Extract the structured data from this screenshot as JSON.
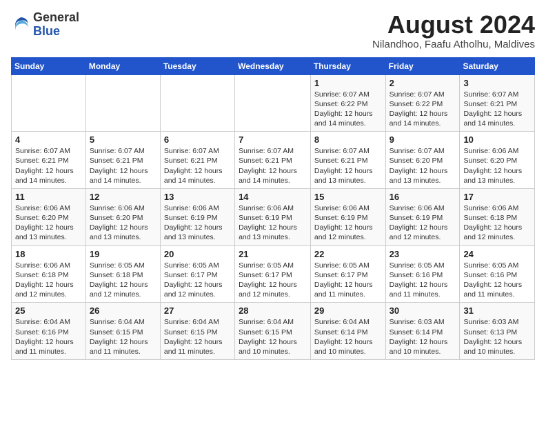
{
  "header": {
    "logo_general": "General",
    "logo_blue": "Blue",
    "title": "August 2024",
    "subtitle": "Nilandhoo, Faafu Atholhu, Maldives"
  },
  "calendar": {
    "days_of_week": [
      "Sunday",
      "Monday",
      "Tuesday",
      "Wednesday",
      "Thursday",
      "Friday",
      "Saturday"
    ],
    "weeks": [
      [
        {
          "day": "",
          "detail": ""
        },
        {
          "day": "",
          "detail": ""
        },
        {
          "day": "",
          "detail": ""
        },
        {
          "day": "",
          "detail": ""
        },
        {
          "day": "1",
          "detail": "Sunrise: 6:07 AM\nSunset: 6:22 PM\nDaylight: 12 hours\nand 14 minutes."
        },
        {
          "day": "2",
          "detail": "Sunrise: 6:07 AM\nSunset: 6:22 PM\nDaylight: 12 hours\nand 14 minutes."
        },
        {
          "day": "3",
          "detail": "Sunrise: 6:07 AM\nSunset: 6:21 PM\nDaylight: 12 hours\nand 14 minutes."
        }
      ],
      [
        {
          "day": "4",
          "detail": "Sunrise: 6:07 AM\nSunset: 6:21 PM\nDaylight: 12 hours\nand 14 minutes."
        },
        {
          "day": "5",
          "detail": "Sunrise: 6:07 AM\nSunset: 6:21 PM\nDaylight: 12 hours\nand 14 minutes."
        },
        {
          "day": "6",
          "detail": "Sunrise: 6:07 AM\nSunset: 6:21 PM\nDaylight: 12 hours\nand 14 minutes."
        },
        {
          "day": "7",
          "detail": "Sunrise: 6:07 AM\nSunset: 6:21 PM\nDaylight: 12 hours\nand 14 minutes."
        },
        {
          "day": "8",
          "detail": "Sunrise: 6:07 AM\nSunset: 6:21 PM\nDaylight: 12 hours\nand 13 minutes."
        },
        {
          "day": "9",
          "detail": "Sunrise: 6:07 AM\nSunset: 6:20 PM\nDaylight: 12 hours\nand 13 minutes."
        },
        {
          "day": "10",
          "detail": "Sunrise: 6:06 AM\nSunset: 6:20 PM\nDaylight: 12 hours\nand 13 minutes."
        }
      ],
      [
        {
          "day": "11",
          "detail": "Sunrise: 6:06 AM\nSunset: 6:20 PM\nDaylight: 12 hours\nand 13 minutes."
        },
        {
          "day": "12",
          "detail": "Sunrise: 6:06 AM\nSunset: 6:20 PM\nDaylight: 12 hours\nand 13 minutes."
        },
        {
          "day": "13",
          "detail": "Sunrise: 6:06 AM\nSunset: 6:19 PM\nDaylight: 12 hours\nand 13 minutes."
        },
        {
          "day": "14",
          "detail": "Sunrise: 6:06 AM\nSunset: 6:19 PM\nDaylight: 12 hours\nand 13 minutes."
        },
        {
          "day": "15",
          "detail": "Sunrise: 6:06 AM\nSunset: 6:19 PM\nDaylight: 12 hours\nand 12 minutes."
        },
        {
          "day": "16",
          "detail": "Sunrise: 6:06 AM\nSunset: 6:19 PM\nDaylight: 12 hours\nand 12 minutes."
        },
        {
          "day": "17",
          "detail": "Sunrise: 6:06 AM\nSunset: 6:18 PM\nDaylight: 12 hours\nand 12 minutes."
        }
      ],
      [
        {
          "day": "18",
          "detail": "Sunrise: 6:06 AM\nSunset: 6:18 PM\nDaylight: 12 hours\nand 12 minutes."
        },
        {
          "day": "19",
          "detail": "Sunrise: 6:05 AM\nSunset: 6:18 PM\nDaylight: 12 hours\nand 12 minutes."
        },
        {
          "day": "20",
          "detail": "Sunrise: 6:05 AM\nSunset: 6:17 PM\nDaylight: 12 hours\nand 12 minutes."
        },
        {
          "day": "21",
          "detail": "Sunrise: 6:05 AM\nSunset: 6:17 PM\nDaylight: 12 hours\nand 12 minutes."
        },
        {
          "day": "22",
          "detail": "Sunrise: 6:05 AM\nSunset: 6:17 PM\nDaylight: 12 hours\nand 11 minutes."
        },
        {
          "day": "23",
          "detail": "Sunrise: 6:05 AM\nSunset: 6:16 PM\nDaylight: 12 hours\nand 11 minutes."
        },
        {
          "day": "24",
          "detail": "Sunrise: 6:05 AM\nSunset: 6:16 PM\nDaylight: 12 hours\nand 11 minutes."
        }
      ],
      [
        {
          "day": "25",
          "detail": "Sunrise: 6:04 AM\nSunset: 6:16 PM\nDaylight: 12 hours\nand 11 minutes."
        },
        {
          "day": "26",
          "detail": "Sunrise: 6:04 AM\nSunset: 6:15 PM\nDaylight: 12 hours\nand 11 minutes."
        },
        {
          "day": "27",
          "detail": "Sunrise: 6:04 AM\nSunset: 6:15 PM\nDaylight: 12 hours\nand 11 minutes."
        },
        {
          "day": "28",
          "detail": "Sunrise: 6:04 AM\nSunset: 6:15 PM\nDaylight: 12 hours\nand 10 minutes."
        },
        {
          "day": "29",
          "detail": "Sunrise: 6:04 AM\nSunset: 6:14 PM\nDaylight: 12 hours\nand 10 minutes."
        },
        {
          "day": "30",
          "detail": "Sunrise: 6:03 AM\nSunset: 6:14 PM\nDaylight: 12 hours\nand 10 minutes."
        },
        {
          "day": "31",
          "detail": "Sunrise: 6:03 AM\nSunset: 6:13 PM\nDaylight: 12 hours\nand 10 minutes."
        }
      ]
    ]
  }
}
